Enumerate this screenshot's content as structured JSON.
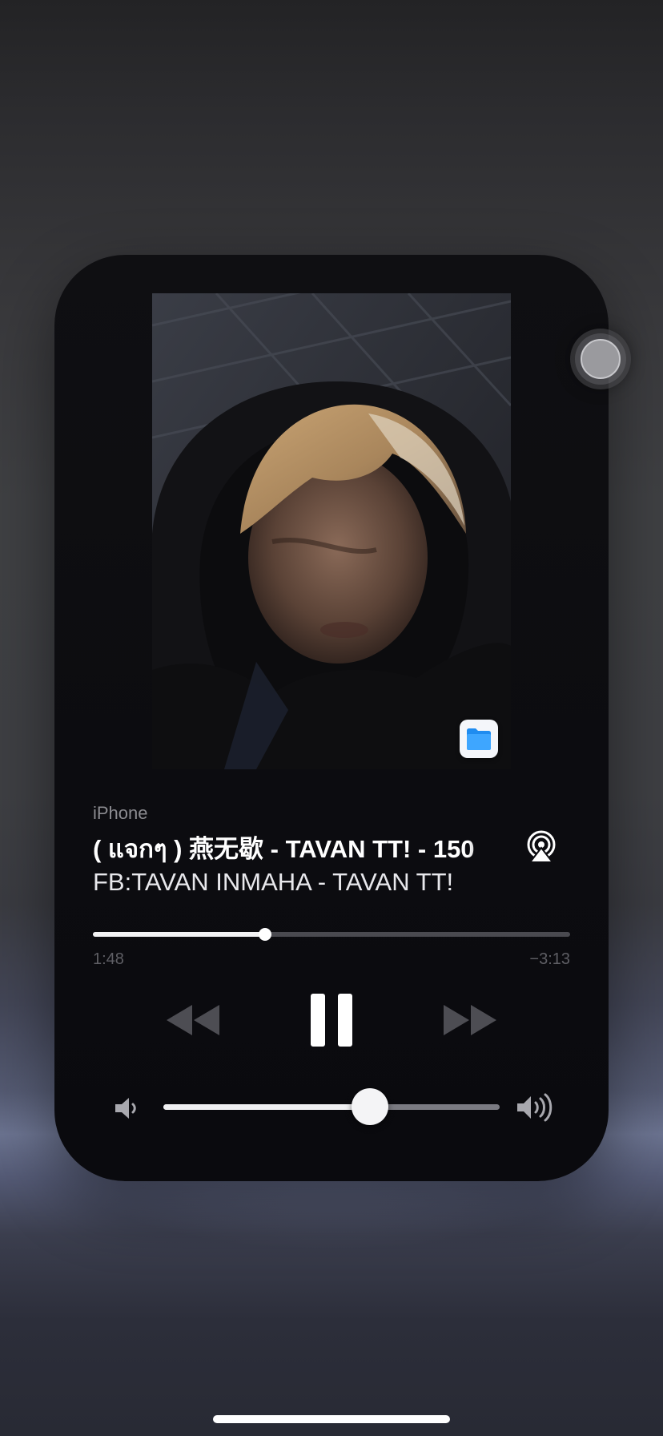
{
  "now_playing": {
    "source": "iPhone",
    "title": "( แจกๆ ) 燕无歇 - TAVAN TT! - 150",
    "artist": "FB:TAVAN INMAHA - TAVAN TT!",
    "artwork_icon": "person-hood-photo",
    "app_badge_icon": "files-app-icon",
    "airplay_icon": "airplay-audio-icon"
  },
  "playback": {
    "elapsed": "1:48",
    "remaining": "−3:13",
    "progress_fraction": 0.36,
    "state": "playing",
    "controls": [
      "rewind-icon",
      "pause-icon",
      "fast-forward-icon"
    ]
  },
  "volume": {
    "level_fraction": 0.615,
    "low_icon": "speaker-low-icon",
    "high_icon": "speaker-high-icon"
  },
  "colors": {
    "card_background": "#0c0c10",
    "progress_fill": "#f2f2f4",
    "progress_track": "#4a4a50",
    "secondary_text": "#8b8b90",
    "disabled_control": "#5a5a60"
  }
}
